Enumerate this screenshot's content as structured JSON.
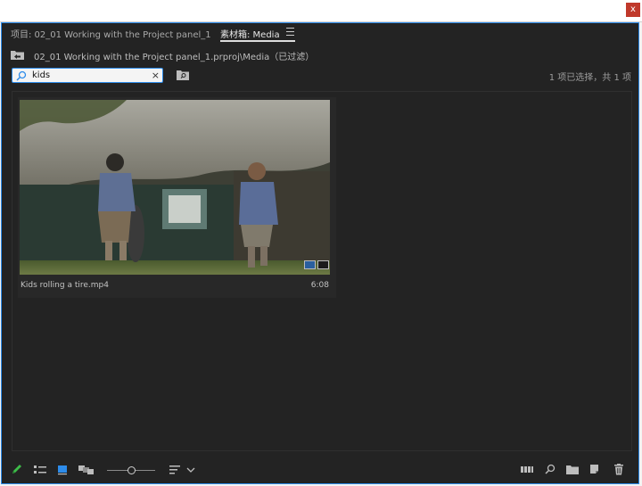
{
  "window": {
    "close_label": "x"
  },
  "tabs": [
    {
      "label": "项目: 02_01 Working with the Project panel_1",
      "active": false
    },
    {
      "label": "素材箱: Media",
      "active": true
    }
  ],
  "path": {
    "text": "02_01 Working with the Project panel_1.prproj\\Media（已过滤）"
  },
  "search": {
    "value": "kids",
    "clear_label": "×"
  },
  "status": {
    "selection": "1 项已选择，共 1 项"
  },
  "clip": {
    "name": "Kids rolling a tire.mp4",
    "duration": "6:08"
  },
  "colors": {
    "accent": "#2d8ceb",
    "panel_bg": "#232323",
    "pen": "#3dbd49"
  },
  "bottom_toolbar": {
    "left_icons": [
      "pencil-icon",
      "list-view-icon",
      "icon-view-icon",
      "freeform-view-icon",
      "zoom-slider",
      "sort-icon",
      "chevron-down-icon"
    ],
    "right_icons": [
      "automate-sequence-icon",
      "find-icon",
      "new-bin-icon",
      "new-item-icon",
      "trash-icon"
    ],
    "zoom_level": 0.5
  }
}
